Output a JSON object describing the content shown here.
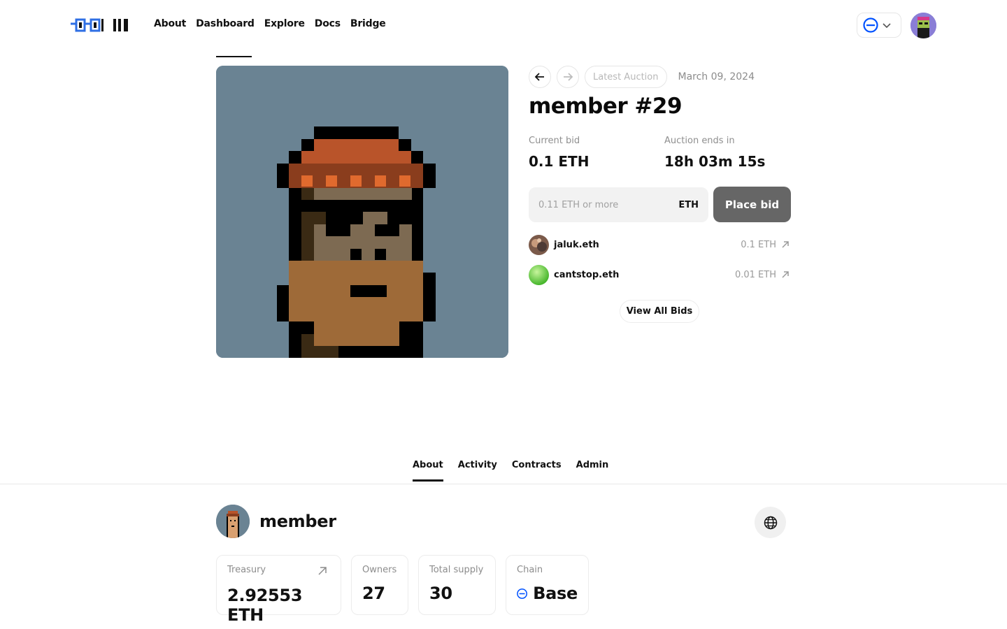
{
  "nav": {
    "links": [
      "About",
      "Dashboard",
      "Explore",
      "Docs",
      "Bridge"
    ]
  },
  "colors": {
    "accent": "#0052ff",
    "primary_button": "#666666",
    "artwork_background": "#6a8393"
  },
  "icons": {
    "chain": "base-chain-icon",
    "chevron": "chevron-down-icon",
    "prev": "arrow-left-icon",
    "next": "arrow-right-icon",
    "external": "arrow-up-right-icon",
    "globe": "globe-icon"
  },
  "auction": {
    "latest_label": "Latest Auction",
    "date": "March 09, 2024",
    "title": "member #29",
    "current_bid_label": "Current bid",
    "current_bid_value": "0.1 ETH",
    "ends_label": "Auction ends in",
    "ends_value": "18h 03m 15s",
    "bid_placeholder": "0.11 ETH or more",
    "bid_unit": "ETH",
    "place_bid_label": "Place bid",
    "bids": [
      {
        "name": "jaluk.eth",
        "amount": "0.1 ETH"
      },
      {
        "name": "cantstop.eth",
        "amount": "0.01 ETH"
      }
    ],
    "view_all_label": "View All Bids"
  },
  "tabs": [
    "About",
    "Activity",
    "Contracts",
    "Admin"
  ],
  "dao": {
    "name": "member",
    "stats": {
      "treasury_label": "Treasury",
      "treasury_value": "2.92553 ETH",
      "owners_label": "Owners",
      "owners_value": "27",
      "supply_label": "Total supply",
      "supply_value": "30",
      "chain_label": "Chain",
      "chain_value": "Base"
    }
  }
}
